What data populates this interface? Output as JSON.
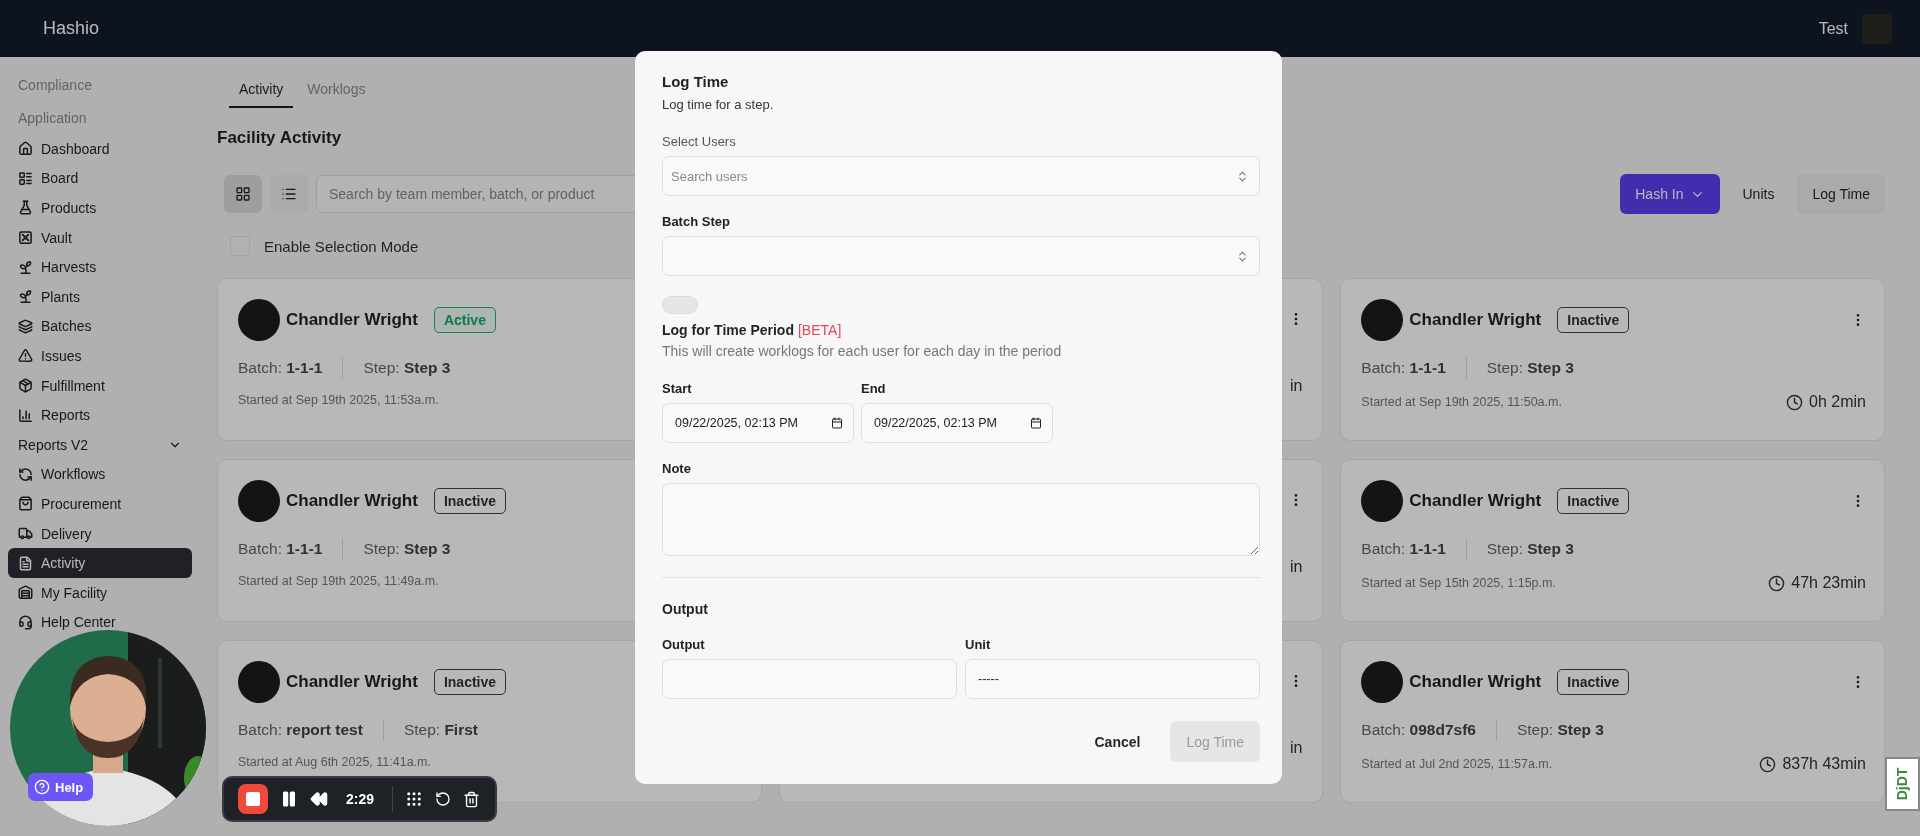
{
  "header": {
    "brand": "Hashio",
    "user": "Test"
  },
  "sidebar": {
    "items": [
      {
        "label": "Compliance",
        "kind": "heading"
      },
      {
        "label": "Application",
        "kind": "heading"
      },
      {
        "label": "Dashboard",
        "kind": "link",
        "selected": false
      },
      {
        "label": "Board",
        "kind": "link",
        "selected": false
      },
      {
        "label": "Products",
        "kind": "link",
        "selected": false
      },
      {
        "label": "Vault",
        "kind": "link",
        "selected": false
      },
      {
        "label": "Harvests",
        "kind": "link",
        "selected": false
      },
      {
        "label": "Plants",
        "kind": "link",
        "selected": false
      },
      {
        "label": "Batches",
        "kind": "link",
        "selected": false
      },
      {
        "label": "Issues",
        "kind": "link",
        "selected": false
      },
      {
        "label": "Fulfillment",
        "kind": "link",
        "selected": false
      },
      {
        "label": "Reports",
        "kind": "link",
        "selected": false
      },
      {
        "label": "Reports V2",
        "kind": "group",
        "selected": false
      },
      {
        "label": "Workflows",
        "kind": "link",
        "selected": false
      },
      {
        "label": "Procurement",
        "kind": "link",
        "selected": false
      },
      {
        "label": "Delivery",
        "kind": "link",
        "selected": false
      },
      {
        "label": "Activity",
        "kind": "link",
        "selected": true
      },
      {
        "label": "My Facility",
        "kind": "link",
        "selected": false
      },
      {
        "label": "Help Center",
        "kind": "link",
        "selected": false
      }
    ]
  },
  "tabs": [
    {
      "label": "Activity",
      "selected": true
    },
    {
      "label": "Worklogs",
      "selected": false
    }
  ],
  "title": "Facility Activity",
  "view_toggle": [
    {
      "selected": true
    },
    {
      "selected": false
    }
  ],
  "search": {
    "placeholder": "Search by team member, batch, or product"
  },
  "actions": [
    {
      "label": "Hash In",
      "kind": "primary"
    },
    {
      "label": "Units",
      "kind": "plain"
    },
    {
      "label": "Log Time",
      "kind": "secondary"
    }
  ],
  "selection_mode": {
    "label": "Enable Selection Mode",
    "checked": false
  },
  "cards": [
    {
      "kind": "clipped",
      "name": "Chandler Wright",
      "status": "Active",
      "active": true,
      "batch": "Batch: **1-1-1**",
      "step": "Step: **Step 3**",
      "started": "Started at Sep 19th 2025, 11:53a.m."
    },
    {
      "kind": "covered",
      "duration": "in"
    },
    {
      "kind": "full",
      "name": "Chandler Wright",
      "status": "Inactive",
      "active": false,
      "batch": "Batch: **1-1-1**",
      "step": "Step: **Step 3**",
      "started": "Started at Sep 19th 2025, 11:50a.m.",
      "duration": "0h 2min"
    },
    {
      "kind": "clipped",
      "name": "Chandler Wright",
      "status": "Inactive",
      "active": false,
      "batch": "Batch: **1-1-1**",
      "step": "Step: **Step 3**",
      "started": "Started at Sep 19th 2025, 11:49a.m."
    },
    {
      "kind": "covered",
      "duration": "in"
    },
    {
      "kind": "full",
      "name": "Chandler Wright",
      "status": "Inactive",
      "active": false,
      "batch": "Batch: **1-1-1**",
      "step": "Step: **Step 3**",
      "started": "Started at Sep 15th 2025, 1:15p.m.",
      "duration": "47h 23min"
    },
    {
      "kind": "clipped",
      "name": "Chandler Wright",
      "status": "Inactive",
      "active": false,
      "batch": "Batch: **report test**",
      "step": "Step: **First**",
      "started": "Started at Aug 6th 2025, 11:41a.m."
    },
    {
      "kind": "covered",
      "duration": "in"
    },
    {
      "kind": "full",
      "name": "Chandler Wright",
      "status": "Inactive",
      "active": false,
      "batch": "Batch: **098d7sf6**",
      "step": "Step: **Step 3**",
      "started": "Started at Jul 2nd 2025, 11:57a.m.",
      "duration": "837h 43min"
    }
  ],
  "modal": {
    "title": "Log Time",
    "subtitle": "Log time for a step.",
    "users": {
      "label": "Select Users",
      "placeholder": "Search users"
    },
    "batch_step": {
      "label": "Batch Step"
    },
    "period": {
      "on": false,
      "label": "Log for Time Period",
      "tag": "[BETA]",
      "description": "This will create worklogs for each user for each day in the period"
    },
    "start": {
      "label": "Start",
      "value": "09/22/2025, 02:13 PM"
    },
    "end": {
      "label": "End",
      "value": "09/22/2025, 02:13 PM"
    },
    "note": {
      "label": "Note"
    },
    "output_heading": "Output",
    "output": {
      "label": "Output"
    },
    "unit": {
      "label": "Unit",
      "value": "-----"
    },
    "buttons": [
      {
        "label": "Cancel",
        "kind": "plain",
        "disabled": false
      },
      {
        "label": "Log Time",
        "kind": "primary",
        "disabled": true
      }
    ]
  },
  "help": {
    "label": "Help"
  },
  "recorder": {
    "time": "2:29"
  },
  "debug_tab": {
    "label": "DjDT"
  }
}
